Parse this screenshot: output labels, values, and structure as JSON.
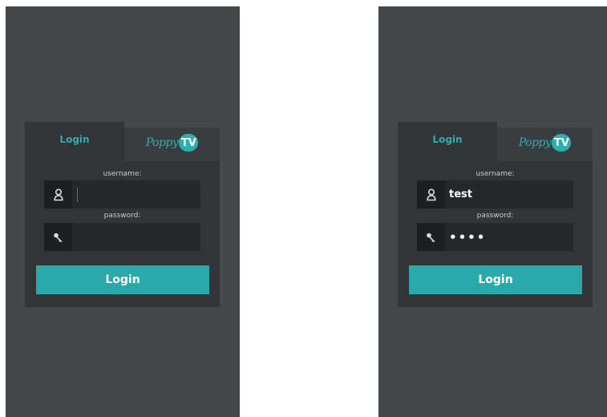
{
  "screens": [
    {
      "id": "left",
      "tabs": {
        "login": "Login",
        "brand_text": "Poppy",
        "brand_badge": "TV"
      },
      "username_label": "username:",
      "username_value": "",
      "password_label": "password:",
      "password_value": "",
      "login_button": "Login",
      "icons": {
        "user": "user-icon",
        "key": "key-icon"
      }
    },
    {
      "id": "right",
      "tabs": {
        "login": "Login",
        "brand_text": "Poppy",
        "brand_badge": "TV"
      },
      "username_label": "username:",
      "username_value": "test",
      "password_label": "password:",
      "password_value": "••••",
      "login_button": "Login",
      "icons": {
        "user": "user-icon",
        "key": "key-icon"
      }
    }
  ],
  "colors": {
    "accent": "#2bb0b2",
    "background": "#44484b",
    "card": "#323537",
    "input": "#25282a"
  }
}
